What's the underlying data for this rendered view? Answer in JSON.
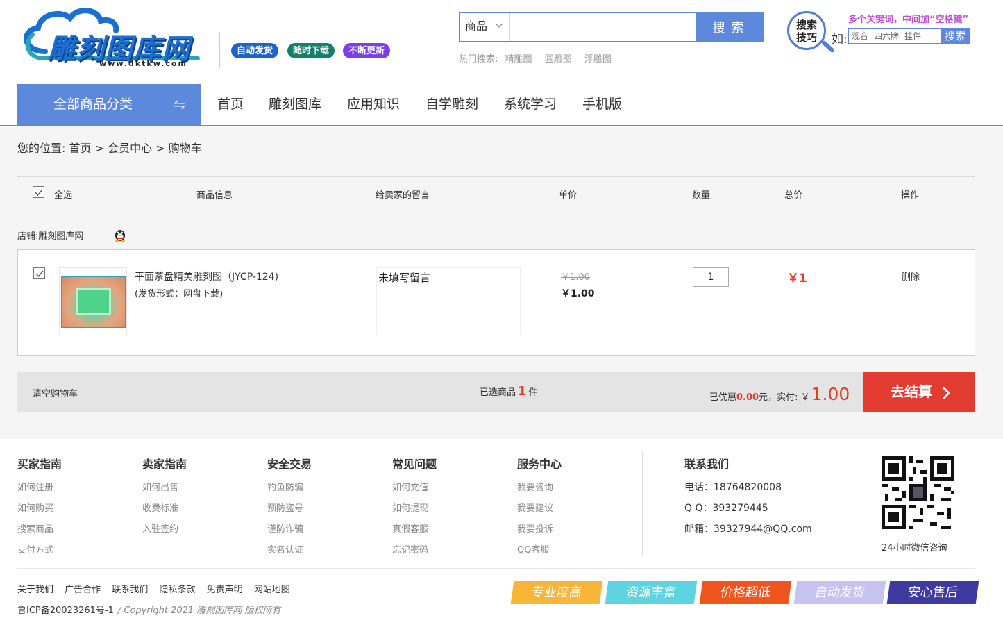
{
  "header": {
    "logo_text": "雕刻图库网",
    "logo_url": "www.dktkw.com",
    "badges": [
      "自动发货",
      "随时下载",
      "不断更新"
    ],
    "search": {
      "category": "商品",
      "placeholder": "",
      "button": "搜 索",
      "hot_label": "热门搜索:",
      "hot": [
        "精雕图",
        "圆雕图",
        "浮雕图"
      ]
    },
    "tips": {
      "title": "搜索技巧",
      "hint": "多个关键词，中间加“空格键”",
      "example_label": "如:",
      "examples": [
        "观音",
        "四六牌",
        "挂件"
      ],
      "example_button": "搜索"
    }
  },
  "nav": {
    "all_categories": "全部商品分类",
    "items": [
      "首页",
      "雕刻图库",
      "应用知识",
      "自学雕刻",
      "系统学习",
      "手机版"
    ]
  },
  "breadcrumb": {
    "label": "您的位置:",
    "path": [
      "首页",
      "会员中心",
      "购物车"
    ],
    "sep": ">"
  },
  "cart": {
    "headers": {
      "select_all": "全选",
      "product": "商品信息",
      "message": "给卖家的留言",
      "unit_price": "单价",
      "quantity": "数量",
      "total": "总价",
      "action": "操作"
    },
    "shop_label": "店铺:",
    "shop_name": "雕刻图库网",
    "items": [
      {
        "name": "平面茶盘精美雕刻图（JYCP-124)",
        "shipping": "(发货形式：网盘下载)",
        "message": "未填写留言",
        "old_price": "￥1.00",
        "price": "￥1.00",
        "quantity": "1",
        "total": "￥1",
        "delete": "删除"
      }
    ],
    "footer": {
      "clear": "清空购物车",
      "selected_prefix": "已选商品",
      "selected_count": "1",
      "selected_suffix": "件",
      "discount_prefix": "已优惠",
      "discount": "0.00",
      "discount_suffix": "元，实付:",
      "currency": "￥",
      "pay": "1.00",
      "checkout": "去结算"
    }
  },
  "footer": {
    "columns": [
      {
        "title": "买家指南",
        "links": [
          "如何注册",
          "如何购买",
          "搜索商品",
          "支付方式"
        ]
      },
      {
        "title": "卖家指南",
        "links": [
          "如何出售",
          "收费标准",
          "入驻签约"
        ]
      },
      {
        "title": "安全交易",
        "links": [
          "钓鱼防骗",
          "预防盗号",
          "谨防诈骗",
          "实名认证"
        ]
      },
      {
        "title": "常见问题",
        "links": [
          "如何充值",
          "如何提现",
          "真假客服",
          "忘记密码"
        ]
      },
      {
        "title": "服务中心",
        "links": [
          "我要咨询",
          "我要建议",
          "我要投诉",
          "QQ客服"
        ]
      }
    ],
    "contact": {
      "title": "联系我们",
      "phone": "电话：18764820008",
      "qq": "Q Q：393279445",
      "email": "邮箱：39327944@QQ.com"
    },
    "qr_label": "24小时微信咨询",
    "links": [
      "关于我们",
      "广告合作",
      "联系我们",
      "隐私条款",
      "免责声明",
      "网站地图"
    ],
    "icp": "鲁ICP备20023261号-1",
    "copyright": "/  Copyright 2021 雕刻图库网 版权所有",
    "tags": [
      "专业度高",
      "资源丰富",
      "价格超低",
      "自动发货",
      "安心售后"
    ]
  },
  "colors": {
    "accent": "#5c89dc",
    "price_red": "#e43f26",
    "checkout": "#e23b30"
  }
}
